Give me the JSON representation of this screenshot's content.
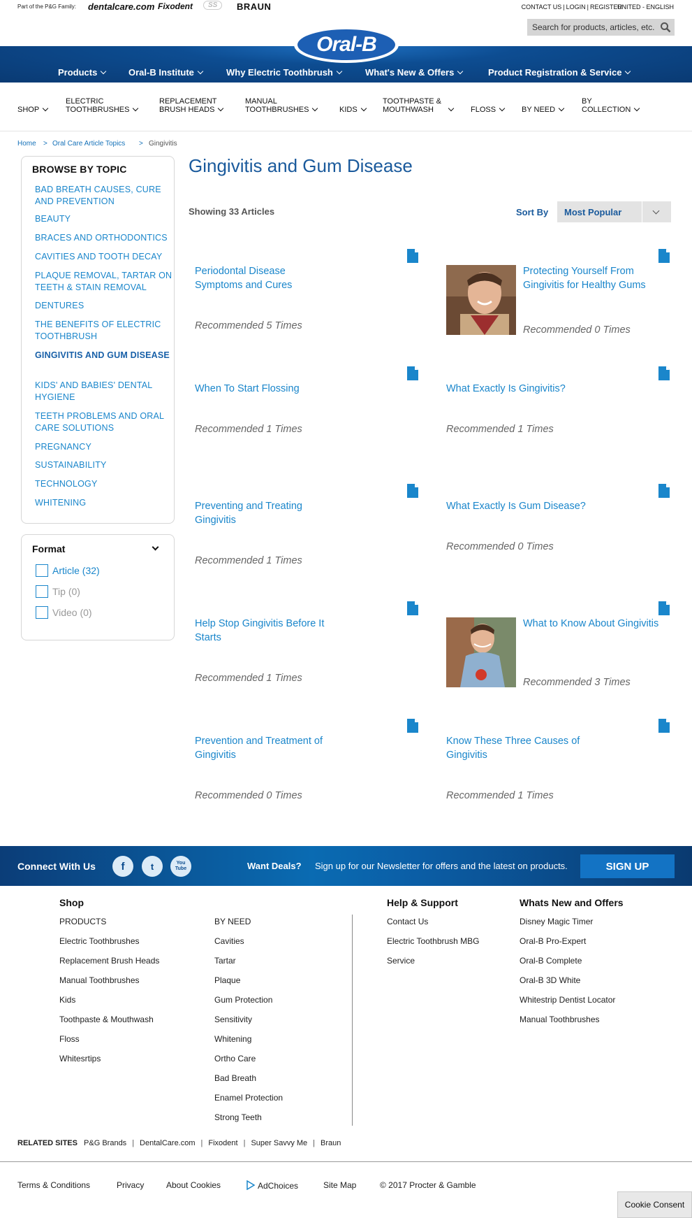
{
  "topbar": {
    "family_label": "Part of the P&G Family:",
    "brands": [
      "dentalcare.com",
      "Fixodent",
      "SS",
      "BRAUN"
    ],
    "links": [
      "CONTACT US",
      "LOGIN",
      "REGISTER"
    ],
    "region": "UNITED - ENGLISH",
    "search_placeholder": "Search for products, articles, etc."
  },
  "logo": "Oral-B",
  "main_nav": [
    "Products",
    "Oral-B Institute",
    "Why Electric Toothbrush",
    "What's New & Offers",
    "Product Registration & Service"
  ],
  "sub_nav": [
    {
      "l1": "SHOP",
      "l2": ""
    },
    {
      "l1": "ELECTRIC",
      "l2": "TOOTHBRUSHES"
    },
    {
      "l1": "REPLACEMENT",
      "l2": "BRUSH HEADS"
    },
    {
      "l1": "MANUAL",
      "l2": "TOOTHBRUSHES"
    },
    {
      "l1": "KIDS",
      "l2": ""
    },
    {
      "l1": "TOOTHPASTE &",
      "l2": "MOUTHWASH"
    },
    {
      "l1": "FLOSS",
      "l2": ""
    },
    {
      "l1": "BY NEED",
      "l2": ""
    },
    {
      "l1": "BY",
      "l2": "COLLECTION"
    }
  ],
  "breadcrumb": [
    "Home",
    "Oral Care Article Topics",
    "Gingivitis"
  ],
  "sidebar": {
    "title": "BROWSE BY TOPIC",
    "topics": [
      "Bad Breath Causes, Cure and Prevention",
      "Beauty",
      "Braces and Orthodontics",
      "Cavities and Tooth Decay",
      "Plaque Removal, Tartar on Teeth & Stain Removal",
      "Dentures",
      "The Benefits of Electric Toothbrush",
      "Gingivitis and Gum Disease",
      "Kids' and Babies' Dental Hygiene",
      "Teeth Problems and Oral Care Solutions",
      "Pregnancy",
      "Sustainability",
      "Technology",
      "Whitening"
    ],
    "active_topic_index": 7,
    "format": {
      "title": "Format",
      "options": [
        {
          "label": "Article (32)",
          "enabled": true
        },
        {
          "label": "Tip (0)",
          "enabled": false
        },
        {
          "label": "Video (0)",
          "enabled": false
        }
      ]
    }
  },
  "main": {
    "title": "Gingivitis and Gum Disease",
    "showing": "Showing 33 Articles",
    "sort_label": "Sort By",
    "sort_value": "Most Popular",
    "articles": [
      {
        "title": "Periodontal Disease Symptoms and Cures",
        "rec": "Recommended 5 Times",
        "image": false
      },
      {
        "title": "Protecting Yourself From Gingivitis for Healthy Gums",
        "rec": "Recommended 0 Times",
        "image": true
      },
      {
        "title": "When To Start Flossing",
        "rec": "Recommended 1 Times",
        "image": false
      },
      {
        "title": "What Exactly Is Gingivitis?",
        "rec": "Recommended 1 Times",
        "image": false
      },
      {
        "title": "Preventing and Treating Gingivitis",
        "rec": "Recommended 1 Times",
        "image": false
      },
      {
        "title": "What Exactly Is Gum Disease?",
        "rec": "Recommended 0 Times",
        "image": false
      },
      {
        "title": "Help Stop Gingivitis Before It Starts",
        "rec": "Recommended 1 Times",
        "image": false
      },
      {
        "title": "What to Know About Gingivitis",
        "rec": "Recommended 3 Times",
        "image": true
      },
      {
        "title": "Prevention and Treatment of Gingivitis",
        "rec": "Recommended 0 Times",
        "image": false
      },
      {
        "title": "Know These Three Causes of Gingivitis",
        "rec": "Recommended 1 Times",
        "image": false
      }
    ]
  },
  "connect": {
    "title": "Connect With Us",
    "social": [
      "f",
      "t",
      "You Tube"
    ],
    "deals_label": "Want Deals?",
    "deals_text": "Sign up for our Newsletter for offers and the latest on products.",
    "signup": "SIGN UP"
  },
  "footer": {
    "shop_title": "Shop",
    "shop_col1": [
      "PRODUCTS",
      "Electric Toothbrushes",
      "Replacement Brush Heads",
      "Manual Toothbrushes",
      "Kids",
      "Toothpaste & Mouthwash",
      "Floss",
      "Whitesrtips"
    ],
    "shop_col2": [
      "BY NEED",
      "Cavities",
      "Tartar",
      "Plaque",
      "Gum Protection",
      "Sensitivity",
      "Whitening",
      "Ortho Care",
      "Bad Breath",
      "Enamel Protection",
      "Strong Teeth"
    ],
    "help_title": "Help & Support",
    "help": [
      "Contact Us",
      "Electric Toothbrush MBG",
      "Service"
    ],
    "new_title": "Whats New and Offers",
    "new": [
      "Disney Magic Timer",
      "Oral-B Pro-Expert",
      "Oral-B Complete",
      "Oral-B 3D White",
      "Whitestrip Dentist Locator",
      "Manual Toothbrushes"
    ],
    "related_label": "RELATED SITES",
    "related": [
      "P&G Brands",
      "DentalCare.com",
      "Fixodent",
      "Super Savvy Me",
      "Braun"
    ],
    "legal": [
      "Terms & Conditions",
      "Privacy",
      "About Cookies",
      "AdChoices",
      "Site Map",
      "© 2017 Procter & Gamble"
    ],
    "cookie": "Cookie Consent"
  },
  "colors": {
    "brand_blue": "#0a3a73",
    "link_blue": "#1a86cb",
    "title_blue": "#1a5a9c"
  }
}
